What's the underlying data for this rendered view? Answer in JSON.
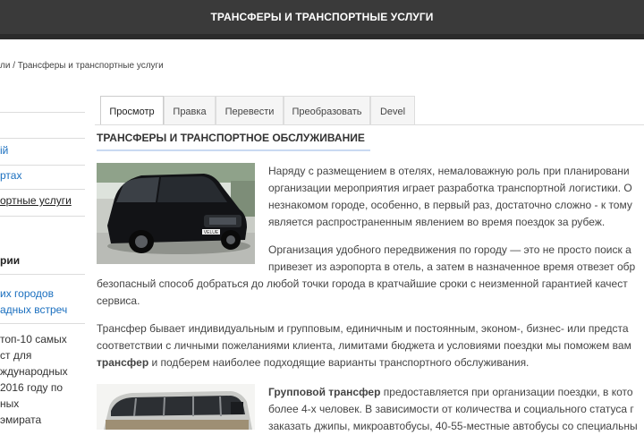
{
  "header": {
    "title": "ТРАНСФЕРЫ И ТРАНСПОРТНЫЕ УСЛУГИ"
  },
  "breadcrumb": {
    "parent": "ли",
    "separator": "/",
    "current": "Трансферы и транспортные услуги"
  },
  "sidebar": {
    "items": [
      {
        "label": "ій",
        "state": "link"
      },
      {
        "label": "ртах",
        "state": "link"
      },
      {
        "label": "ортные услуги",
        "state": "active"
      }
    ],
    "section_title": "рии",
    "section_links": [
      "их городов",
      "адных встреч"
    ],
    "text_lines": [
      "топ-10 самых",
      "ст для",
      "ждународных",
      "2016 году по",
      "ных",
      "эмирата"
    ]
  },
  "tabs": [
    {
      "label": "Просмотр",
      "active": true
    },
    {
      "label": "Правка",
      "active": false
    },
    {
      "label": "Перевести",
      "active": false
    },
    {
      "label": "Преобразовать",
      "active": false
    },
    {
      "label": "Devel",
      "active": false
    }
  ],
  "article": {
    "heading": "ТРАНСФЕРЫ И ТРАНСПОРТНОЕ ОБСЛУЖИВАНИЕ",
    "minivan_plate": "VELUE",
    "p1": [
      "Наряду с размещением в отелях, немаловажную роль при планировани",
      "организации мероприятия играет разработка транспортной логистики. О",
      "незнакомом городе, особенно, в первый раз, достаточно сложно - к тому",
      "является распространенным явлением во время поездок за рубеж."
    ],
    "p2": [
      "Организация удобного передвижения по городу — это не просто поиск а",
      "привезет из аэропорта в отель, а затем в назначенное время отвезет обр",
      "безопасный способ добраться до любой точки города в кратчайшие сроки с неизменной гарантией качест",
      "сервиса."
    ],
    "p3_line1": "Трансфер бывает индивидуальным и групповым, единичным и постоянным, эконом-, бизнес- или предста",
    "p3_line2": "соответствии с личными пожеланиями клиента, лимитами бюджета и условиями поездки мы поможем вам",
    "p3_bold": "трансфер",
    "p3_line3_rest": " и подберем наиболее подходящие варианты транспортного обслуживания.",
    "p4_bold": "Групповой трансфер",
    "p4_line1_rest": " предоставляется при организации поездки, в кото",
    "p4_line2": "более 4-х человек. В зависимости от количества и социального статуса г",
    "p4_line3": "заказать джипы, микроавтобусы, 40-55-местные автобусы со специальны"
  }
}
